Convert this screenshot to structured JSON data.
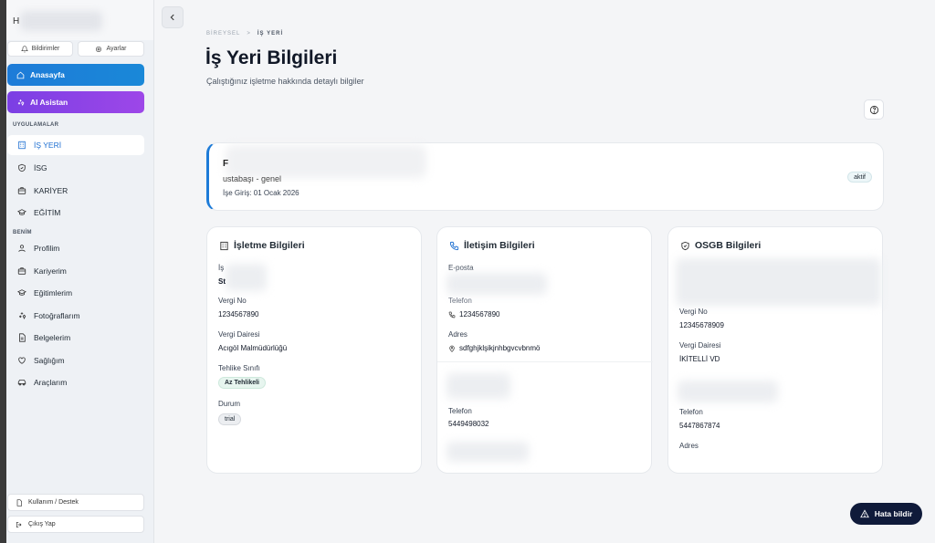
{
  "sidebar": {
    "user_initial": "H",
    "notifications_label": "Bildirimler",
    "settings_label": "Ayarlar",
    "home_label": "Anasayfa",
    "ai_label": "AI Asistan",
    "apps_section": "UYGULAMALAR",
    "apps": [
      {
        "label": "İŞ YERİ",
        "icon": "building-icon"
      },
      {
        "label": "İSG",
        "icon": "shield-icon"
      },
      {
        "label": "KARİYER",
        "icon": "briefcase-icon"
      },
      {
        "label": "EĞİTİM",
        "icon": "graduation-cap-icon"
      }
    ],
    "me_section": "BENİM",
    "me_items": [
      {
        "label": "Profilim",
        "icon": "user-icon"
      },
      {
        "label": "Kariyerim",
        "icon": "briefcase-icon"
      },
      {
        "label": "Eğitimlerim",
        "icon": "graduation-cap-icon"
      },
      {
        "label": "Fotoğraflarım",
        "icon": "sparkles-icon"
      },
      {
        "label": "Belgelerim",
        "icon": "document-icon"
      },
      {
        "label": "Sağlığım",
        "icon": "heart-icon"
      },
      {
        "label": "Araçlarım",
        "icon": "car-icon"
      }
    ],
    "support_label": "Kullanım / Destek",
    "logout_label": "Çıkış Yap"
  },
  "breadcrumb": {
    "parent": "BİREYSEL",
    "separator": ">",
    "current": "İŞ YERİ"
  },
  "header": {
    "title": "İş Yeri Bilgileri",
    "subtitle": "Çalıştığınız işletme hakkında detaylı bilgiler"
  },
  "employee": {
    "initial": "F",
    "position": "ustabaşı - genel",
    "start_date": "İşe Giriş: 01 Ocak 2026",
    "status": "aktif"
  },
  "business": {
    "title": "İşletme Bilgileri",
    "name_label_partial": "İş",
    "name_value_partial": "St",
    "tax_no_label": "Vergi No",
    "tax_no": "1234567890",
    "tax_office_label": "Vergi Dairesi",
    "tax_office": "Acıgöl Malmüdürlüğü",
    "hazard_label": "Tehlike Sınıfı",
    "hazard": "Az Tehlikeli",
    "status_label": "Durum",
    "status": "trial"
  },
  "contact": {
    "title": "İletişim Bilgileri",
    "email_label": "E-posta",
    "phone_label_partial": "Telefon",
    "phone": "1234567890",
    "address_label": "Adres",
    "address": "sdfghjklşikjnhbgvcvbnmö",
    "phone2_label": "Telefon",
    "phone2": "5449498032"
  },
  "osgb": {
    "title": "OSGB Bilgileri",
    "tax_no_label": "Vergi No",
    "tax_no": "12345678909",
    "tax_office_label": "Vergi Dairesi",
    "tax_office": "İKİTELLİ VD",
    "phone_label": "Telefon",
    "phone": "5447867874",
    "address_label": "Adres"
  },
  "report_button": "Hata bildir",
  "colors": {
    "primary": "#1d7bd8",
    "ai": "#8a44e6",
    "dark_button": "#0f1a3a"
  }
}
